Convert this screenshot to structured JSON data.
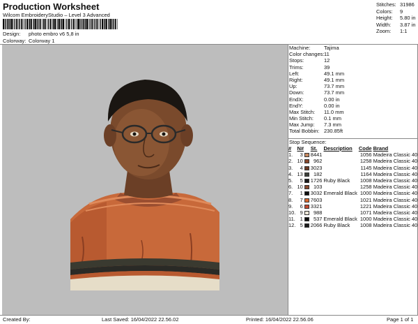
{
  "header": {
    "title": "Production Worksheet",
    "subtitle": "Wilcom EmbroideryStudio – Level 3 Advanced",
    "design_label": "Design:",
    "design_value": "photo embro v6 5,8 in",
    "colorway_label": "Colorway:",
    "colorway_value": "Colorway 1"
  },
  "top_stats": [
    {
      "label": "Stitches:",
      "value": "31986"
    },
    {
      "label": "Colors:",
      "value": "9"
    },
    {
      "label": "Height:",
      "value": "5.80 in"
    },
    {
      "label": "Width:",
      "value": "3.87 in"
    },
    {
      "label": "Zoom:",
      "value": "1:1"
    }
  ],
  "machine_info": [
    {
      "label": "Machine:",
      "value": "Tajima"
    },
    {
      "label": "Color changes:",
      "value": "11"
    },
    {
      "label": "Stops:",
      "value": "12"
    },
    {
      "label": "Trims:",
      "value": "39"
    },
    {
      "label": "Left:",
      "value": "49.1 mm"
    },
    {
      "label": "Right:",
      "value": "49.1 mm"
    },
    {
      "label": "Up:",
      "value": "73.7 mm"
    },
    {
      "label": "Down:",
      "value": "73.7 mm"
    },
    {
      "label": "EndX:",
      "value": "0.00 in"
    },
    {
      "label": "EndY:",
      "value": "0.00 in"
    },
    {
      "label": "Max Stitch:",
      "value": "11.0 mm"
    },
    {
      "label": "Min Stitch:",
      "value": "0.1 mm"
    },
    {
      "label": "Max Jump:",
      "value": "7.3 mm"
    },
    {
      "label": "Total Bobbin:",
      "value": "230.85ft"
    }
  ],
  "sequence": {
    "label": "Stop Sequence:",
    "headers": [
      "#",
      "N#",
      "St.",
      "Description",
      "Code",
      "Brand"
    ],
    "rows": [
      {
        "n": "1.",
        "needle": "3",
        "color": "#c88a62",
        "st": "8441",
        "desc": "",
        "code": "1056",
        "brand": "Madeira Classic 40"
      },
      {
        "n": "2.",
        "needle": "10",
        "color": "#8a4a2e",
        "st": "962",
        "desc": "",
        "code": "1258",
        "brand": "Madeira Classic 40"
      },
      {
        "n": "3.",
        "needle": "4",
        "color": "#6b3a25",
        "st": "3023",
        "desc": "",
        "code": "1145",
        "brand": "Madeira Classic 40"
      },
      {
        "n": "4.",
        "needle": "13",
        "color": "#3c3f3a",
        "st": "182",
        "desc": "",
        "code": "1164",
        "brand": "Madeira Classic 40"
      },
      {
        "n": "5.",
        "needle": "5",
        "color": "#1c1c1c",
        "st": "1726",
        "desc": "Ruby Black",
        "code": "1008",
        "brand": "Madeira Classic 40"
      },
      {
        "n": "6.",
        "needle": "10",
        "color": "#8a4a2e",
        "st": "103",
        "desc": "",
        "code": "1258",
        "brand": "Madeira Classic 40"
      },
      {
        "n": "7.",
        "needle": "1",
        "color": "#0e0e0e",
        "st": "3032",
        "desc": "Emerald Black",
        "code": "1000",
        "brand": "Madeira Classic 40"
      },
      {
        "n": "8.",
        "needle": "7",
        "color": "#d8682e",
        "st": "7603",
        "desc": "",
        "code": "1021",
        "brand": "Madeira Classic 40"
      },
      {
        "n": "9.",
        "needle": "6",
        "color": "#c44a30",
        "st": "3321",
        "desc": "",
        "code": "1221",
        "brand": "Madeira Classic 40"
      },
      {
        "n": "10.",
        "needle": "9",
        "color": "#ece6d8",
        "st": "988",
        "desc": "",
        "code": "1071",
        "brand": "Madeira Classic 40"
      },
      {
        "n": "11.",
        "needle": "1",
        "color": "#0e0e0e",
        "st": "537",
        "desc": "Emerald Black",
        "code": "1000",
        "brand": "Madeira Classic 40"
      },
      {
        "n": "12.",
        "needle": "5",
        "color": "#1c1c1c",
        "st": "2066",
        "desc": "Ruby Black",
        "code": "1008",
        "brand": "Madeira Classic 40"
      }
    ]
  },
  "footer": {
    "created": "Created By:",
    "last_saved": "Last Saved: 16/04/2022 22.56.02",
    "printed": "Printed: 16/04/2022 22.56.06",
    "page": "Page 1 of 1"
  }
}
